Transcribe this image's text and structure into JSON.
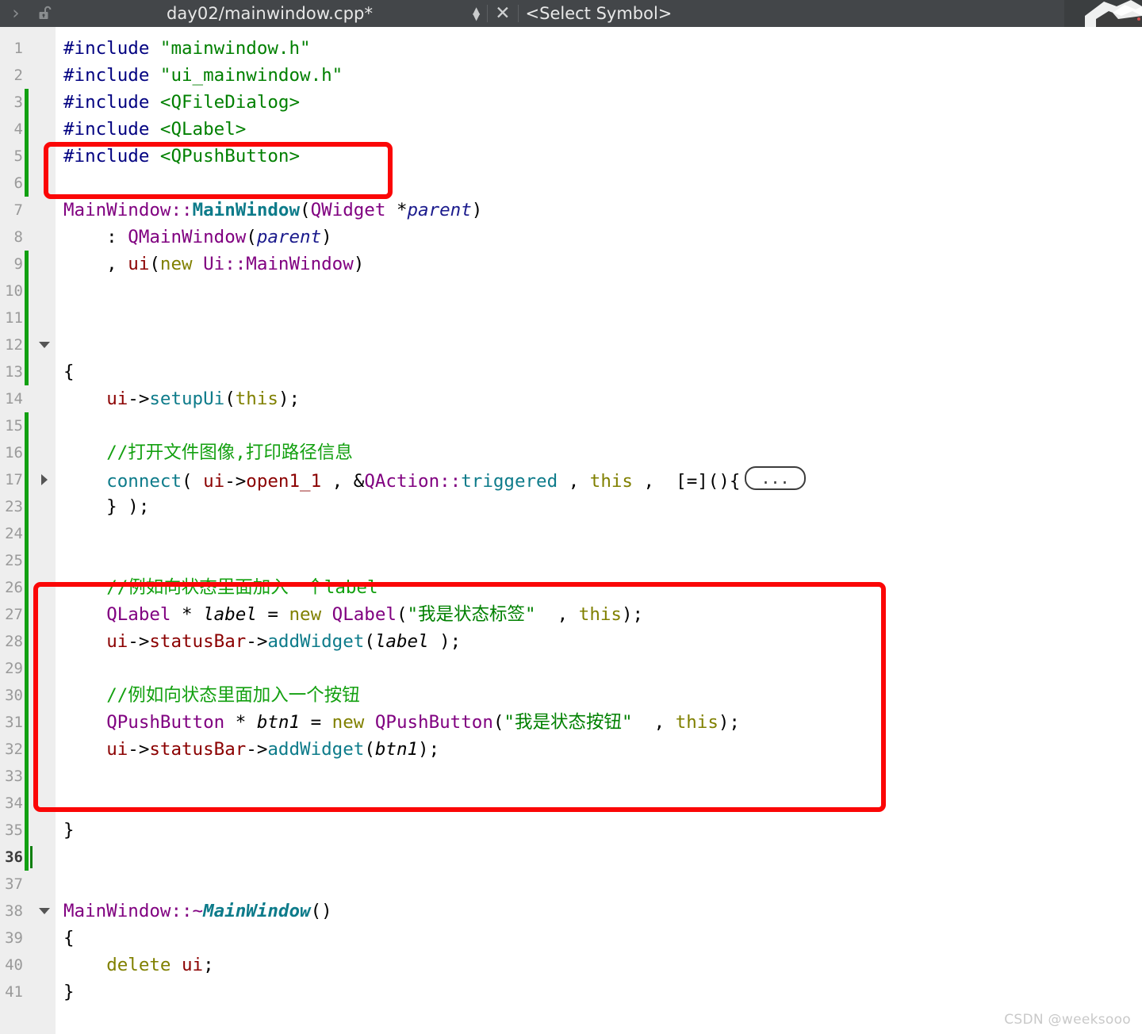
{
  "window": {
    "titlebar": {
      "nav_chevron": "›",
      "lock_icon_name": "unlocked-padlock",
      "file_title": "day02/mainwindow.cpp*",
      "stepper_up": "▲",
      "stepper_down": "▼",
      "close_label": "✕",
      "select_symbol": "<Select Symbol>"
    },
    "watermark": "CSDN @weeksooo"
  },
  "colors": {
    "titlebar_bg": "#434649",
    "gutter_bg": "#eeeeee",
    "editor_bg": "#ffffff",
    "change_marker": "#11a011",
    "annotation_red": "#fb0606",
    "comment_green": "#13a010",
    "string_green": "#008000",
    "preproc_navy": "#000080",
    "type_purple": "#800080",
    "function_teal": "#0d7b8a",
    "keyword_olive": "#808000",
    "member_darkred": "#8b0000"
  },
  "editor": {
    "fold_placeholder": "...",
    "current_line": 36,
    "lines": [
      {
        "num": "1",
        "changed": false,
        "fold": "",
        "current": false
      },
      {
        "num": "2",
        "changed": false,
        "fold": "",
        "current": false
      },
      {
        "num": "3",
        "changed": true,
        "fold": "",
        "current": false
      },
      {
        "num": "4",
        "changed": true,
        "fold": "",
        "current": false
      },
      {
        "num": "5",
        "changed": true,
        "fold": "",
        "current": false
      },
      {
        "num": "6",
        "changed": true,
        "fold": "",
        "current": false
      },
      {
        "num": "7",
        "changed": false,
        "fold": "",
        "current": false
      },
      {
        "num": "8",
        "changed": false,
        "fold": "",
        "current": false
      },
      {
        "num": "9",
        "changed": true,
        "fold": "",
        "current": false
      },
      {
        "num": "10",
        "changed": true,
        "fold": "",
        "current": false
      },
      {
        "num": "11",
        "changed": true,
        "fold": "",
        "current": false
      },
      {
        "num": "12",
        "changed": true,
        "fold": "down",
        "current": false
      },
      {
        "num": "13",
        "changed": true,
        "fold": "",
        "current": false
      },
      {
        "num": "14",
        "changed": false,
        "fold": "",
        "current": false
      },
      {
        "num": "15",
        "changed": true,
        "fold": "",
        "current": false
      },
      {
        "num": "16",
        "changed": true,
        "fold": "",
        "current": false
      },
      {
        "num": "17",
        "changed": true,
        "fold": "right",
        "current": false
      },
      {
        "num": "23",
        "changed": true,
        "fold": "",
        "current": false
      },
      {
        "num": "24",
        "changed": true,
        "fold": "",
        "current": false
      },
      {
        "num": "25",
        "changed": true,
        "fold": "",
        "current": false
      },
      {
        "num": "26",
        "changed": true,
        "fold": "",
        "current": false
      },
      {
        "num": "27",
        "changed": true,
        "fold": "",
        "current": false
      },
      {
        "num": "28",
        "changed": true,
        "fold": "",
        "current": false
      },
      {
        "num": "29",
        "changed": true,
        "fold": "",
        "current": false
      },
      {
        "num": "30",
        "changed": true,
        "fold": "",
        "current": false
      },
      {
        "num": "31",
        "changed": true,
        "fold": "",
        "current": false
      },
      {
        "num": "32",
        "changed": true,
        "fold": "",
        "current": false
      },
      {
        "num": "33",
        "changed": true,
        "fold": "",
        "current": false
      },
      {
        "num": "34",
        "changed": true,
        "fold": "",
        "current": false
      },
      {
        "num": "35",
        "changed": true,
        "fold": "",
        "current": false
      },
      {
        "num": "36",
        "changed": true,
        "fold": "",
        "current": true
      },
      {
        "num": "37",
        "changed": false,
        "fold": "",
        "current": false
      },
      {
        "num": "38",
        "changed": false,
        "fold": "down",
        "current": false
      },
      {
        "num": "39",
        "changed": false,
        "fold": "",
        "current": false
      },
      {
        "num": "40",
        "changed": false,
        "fold": "",
        "current": false
      },
      {
        "num": "41",
        "changed": false,
        "fold": "",
        "current": false
      }
    ],
    "source_text": [
      "#include \"mainwindow.h\"",
      "#include \"ui_mainwindow.h\"",
      "#include <QFileDialog>",
      "#include <QLabel>",
      "#include <QPushButton>",
      "",
      "MainWindow::MainWindow(QWidget *parent)",
      "    : QMainWindow(parent)",
      "    , ui(new Ui::MainWindow)",
      "",
      "",
      "",
      "{",
      "    ui->setupUi(this);",
      "",
      "    //打开文件图像,打印路径信息",
      "    connect( ui->open1_1 , &QAction::triggered , this ,  [=](){ ... ",
      "    } );",
      "",
      "",
      "    //例如向状态里面加入一个label",
      "    QLabel * label = new QLabel(\"我是状态标签\"  , this);",
      "    ui->statusBar->addWidget(label );",
      "",
      "    //例如向状态里面加入一个按钮",
      "    QPushButton * btn1 = new QPushButton(\"我是状态按钮\"  , this);",
      "    ui->statusBar->addWidget(btn1);",
      "",
      "",
      "}",
      "",
      "",
      "MainWindow::~MainWindow()",
      "{",
      "    delete ui;",
      "}"
    ]
  },
  "annotations": [
    {
      "id": "redbox-includes",
      "target": "#include <QLabel> / #include <QPushButton>"
    },
    {
      "id": "redbox-status",
      "target": "status bar label and button block (lines 26-32)"
    }
  ]
}
